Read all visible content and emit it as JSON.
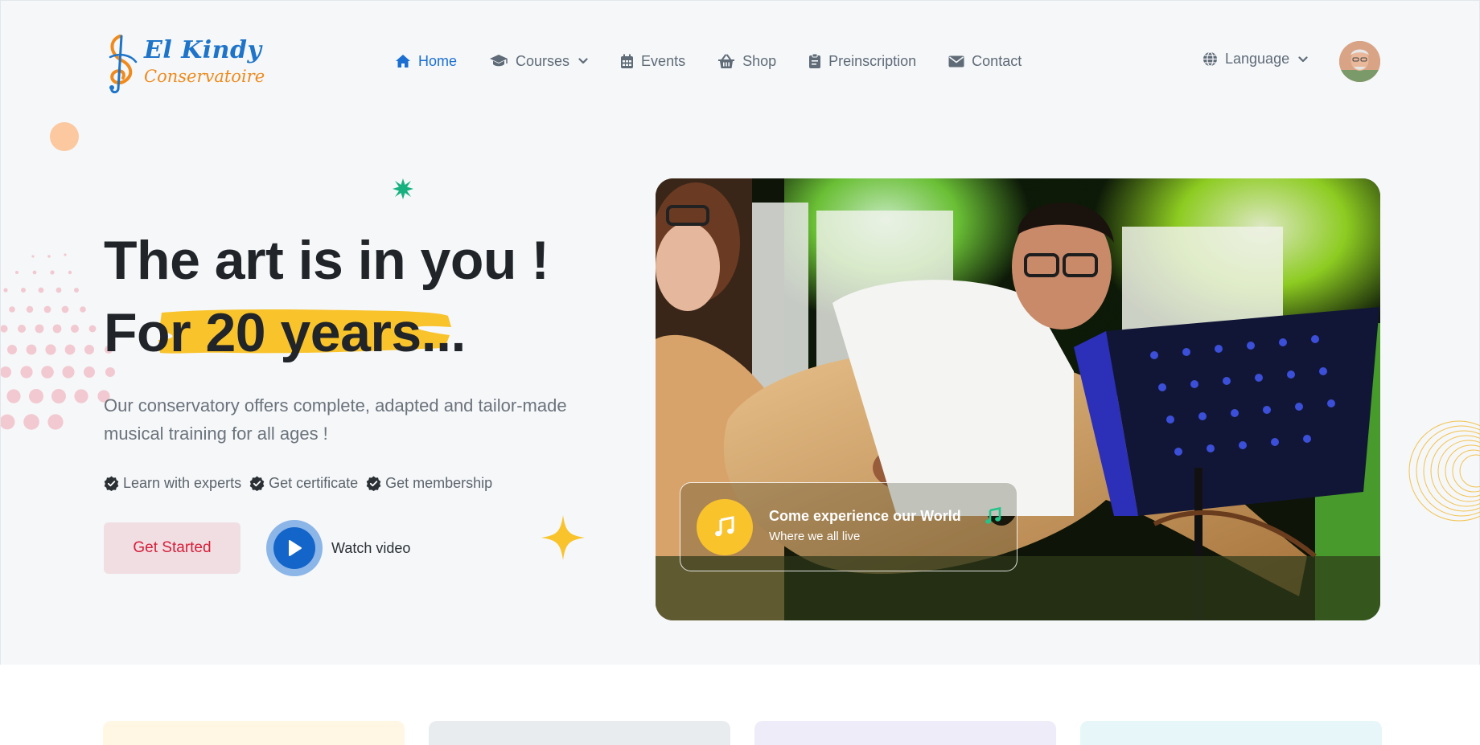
{
  "brand": {
    "name_line1": "El Kindy",
    "name_line2": "Conservatoire",
    "logo_icon": "treble-clef-logo"
  },
  "nav": {
    "items": [
      {
        "label": "Home",
        "icon": "home-icon",
        "active": true
      },
      {
        "label": "Courses",
        "icon": "graduation-cap-icon",
        "has_dropdown": true
      },
      {
        "label": "Events",
        "icon": "calendar-icon"
      },
      {
        "label": "Shop",
        "icon": "basket-icon"
      },
      {
        "label": "Preinscription",
        "icon": "clipboard-icon"
      },
      {
        "label": "Contact",
        "icon": "envelope-icon"
      }
    ],
    "language_label": "Language",
    "language_icon": "globe-icon",
    "avatar_icon": "user-avatar"
  },
  "hero": {
    "title_line1": "The art is in you !",
    "title_line2_prefix": "For ",
    "title_line2_highlight": "20 years...",
    "description": "Our conservatory offers complete, adapted and tailor-made musical training for all ages !",
    "features": [
      {
        "label": "Learn with experts",
        "icon": "check-badge-icon"
      },
      {
        "label": "Get certificate",
        "icon": "check-badge-icon"
      },
      {
        "label": "Get membership",
        "icon": "check-badge-icon"
      }
    ],
    "cta_label": "Get Started",
    "watch_label": "Watch video",
    "photo_card": {
      "title": "Come experience our World",
      "subtitle": "Where we all live",
      "icon": "music-note-icon"
    }
  },
  "colors": {
    "accent_blue": "#1b6fd1",
    "highlight_yellow": "#f9c32c",
    "cta_text": "#d51f3a",
    "cta_bg": "#f1dee2",
    "hero_bg": "#f5f7f9",
    "card_colors": [
      "#fff6e4",
      "#e9ecef",
      "#efecf9",
      "#e6f6f9"
    ]
  }
}
